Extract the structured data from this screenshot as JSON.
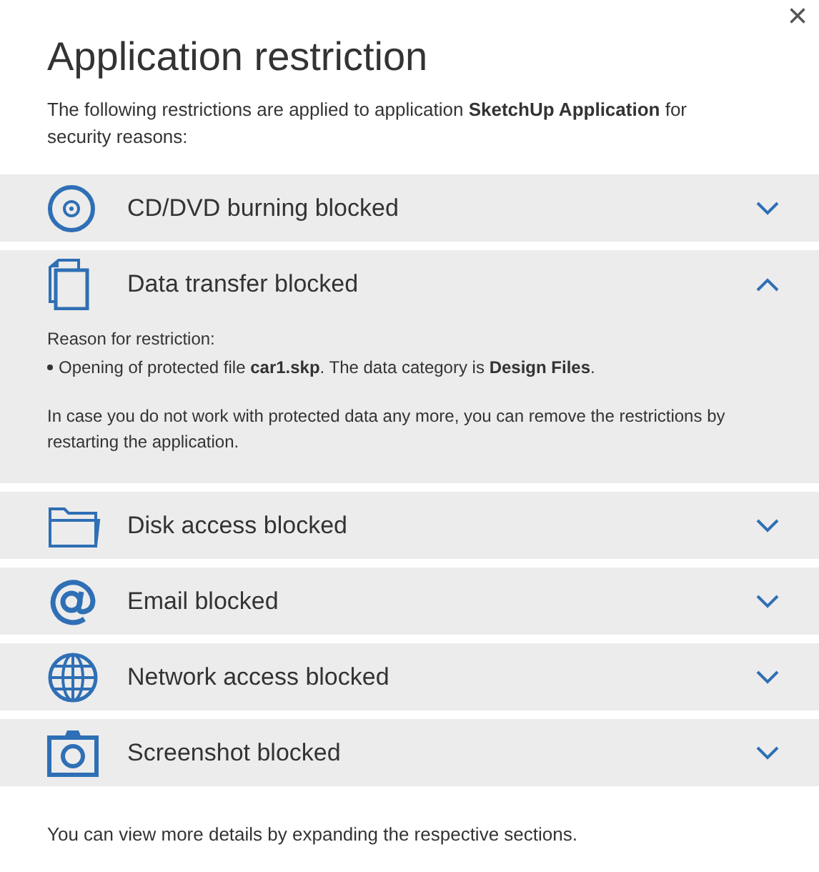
{
  "dialog": {
    "title": "Application restriction",
    "close": "×",
    "intro": "The following restrictions are applied to application **SketchUp Application** for security reasons:"
  },
  "sections": [
    {
      "kind": "disc",
      "label": "CD/DVD burning blocked",
      "expanded": false
    },
    {
      "kind": "documents",
      "label": "Data transfer blocked",
      "expanded": true,
      "details": {
        "heading": "Reason for restriction:",
        "reasons": [
          "Opening of protected file **car1.skp**. The data category is **Design Files**."
        ],
        "note": "In case you do not work with protected data any more, you can remove the restrictions by\nrestarting the application."
      }
    },
    {
      "kind": "folder",
      "label": "Disk access blocked",
      "expanded": false
    },
    {
      "kind": "at",
      "label": "Email blocked",
      "expanded": false
    },
    {
      "kind": "globe",
      "label": "Network access blocked",
      "expanded": false
    },
    {
      "kind": "camera",
      "label": "Screenshot blocked",
      "expanded": false
    }
  ],
  "footer": "You can view more details by expanding the respective sections."
}
